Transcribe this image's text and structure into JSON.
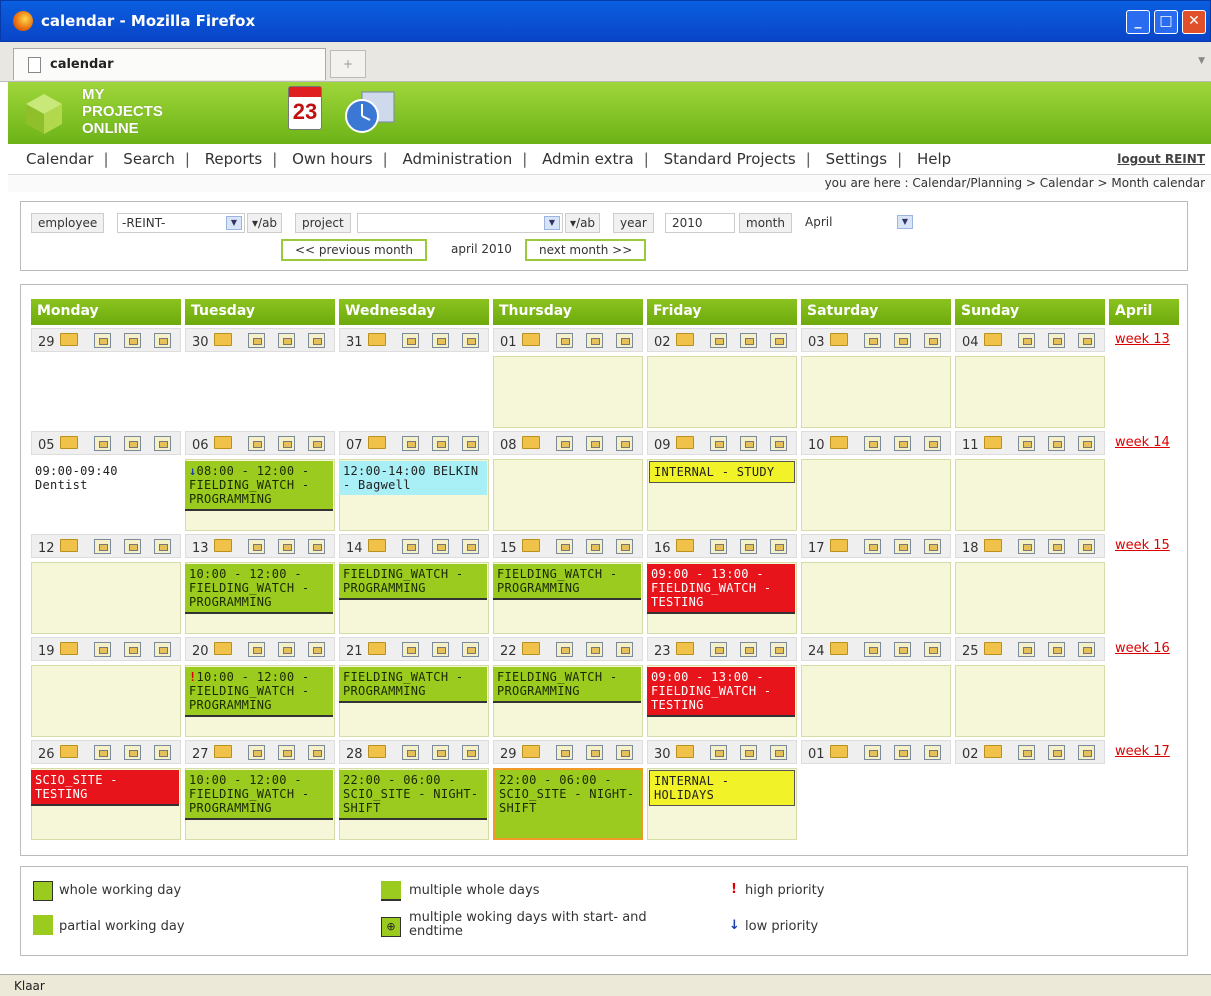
{
  "window": {
    "title": "calendar - Mozilla Firefox"
  },
  "tab": {
    "label": "calendar",
    "new_tab": "+"
  },
  "logo": {
    "line1": "MY",
    "line2": "PROJECTS",
    "line3": "ONLINE",
    "cal_number": "23"
  },
  "menu": {
    "items": [
      "Calendar",
      "Search",
      "Reports",
      "Own hours",
      "Administration",
      "Admin extra",
      "Standard Projects",
      "Settings",
      "Help"
    ],
    "separator": "|",
    "logout": "logout REINT"
  },
  "breadcrumb": "you are here : Calendar/Planning > Calendar > Month calendar",
  "filter": {
    "employee_label": "employee",
    "employee_value": "-REINT-",
    "toggle1": "▾/ab",
    "project_label": "project",
    "project_value": "",
    "toggle2": "▾/ab",
    "year_label": "year",
    "year_value": "2010",
    "month_label": "month",
    "month_value": "April",
    "prev": "<< previous month",
    "current": "april 2010",
    "next": "next month >>"
  },
  "calendar": {
    "headers": [
      "Monday",
      "Tuesday",
      "Wednesday",
      "Thursday",
      "Friday",
      "Saturday",
      "Sunday",
      "April"
    ],
    "weeks": [
      {
        "days": [
          "29",
          "30",
          "31",
          "01",
          "02",
          "03",
          "04"
        ],
        "week_label": "week 13"
      },
      {
        "days": [
          "05",
          "06",
          "07",
          "08",
          "09",
          "10",
          "11"
        ],
        "week_label": "week 14"
      },
      {
        "days": [
          "12",
          "13",
          "14",
          "15",
          "16",
          "17",
          "18"
        ],
        "week_label": "week 15"
      },
      {
        "days": [
          "19",
          "20",
          "21",
          "22",
          "23",
          "24",
          "25"
        ],
        "week_label": "week 16"
      },
      {
        "days": [
          "26",
          "27",
          "28",
          "29",
          "30",
          "01",
          "02"
        ],
        "week_label": "week 17"
      }
    ],
    "events": {
      "w2_mon": "09:00-09:40 Dentist",
      "w2_tue": "08:00 - 12:00 - FIELDING_WATCH - PROGRAMMING",
      "w2_tue_icon": "↓",
      "w2_wed": "12:00-14:00 BELKIN - Bagwell",
      "w2_fri": "INTERNAL - STUDY",
      "w3_tue": "10:00 - 12:00 - FIELDING_WATCH - PROGRAMMING",
      "w3_wed": "FIELDING_WATCH - PROGRAMMING",
      "w3_thu": "FIELDING_WATCH - PROGRAMMING",
      "w3_fri": "09:00 - 13:00 - FIELDING_WATCH - TESTING",
      "w4_tue": "10:00 - 12:00 - FIELDING_WATCH - PROGRAMMING",
      "w4_tue_icon": "!",
      "w4_wed": "FIELDING_WATCH - PROGRAMMING",
      "w4_thu": "FIELDING_WATCH - PROGRAMMING",
      "w4_fri": "09:00 - 13:00 - FIELDING_WATCH - TESTING",
      "w5_mon": "SCIO_SITE - TESTING",
      "w5_tue": "10:00 - 12:00 - FIELDING_WATCH - PROGRAMMING",
      "w5_wed": "22:00 - 06:00 - SCIO_SITE - NIGHT-SHIFT",
      "w5_thu": "22:00 - 06:00 - SCIO_SITE - NIGHT-SHIFT",
      "w5_fri": "INTERNAL - HOLIDAYS"
    }
  },
  "legend": {
    "whole": "whole working day",
    "partial": "partial working day",
    "multiple": "multiple whole days",
    "multiple_time": "multiple woking days with start- and endtime",
    "high": "high priority",
    "high_icon": "!",
    "low": "low priority",
    "low_icon": "↓"
  },
  "status": "Klaar",
  "colors": {
    "accent_green": "#9ccb1f",
    "red_event": "#e8141b",
    "yellow_event": "#f2f229",
    "cyan_event": "#a8f0f6"
  }
}
